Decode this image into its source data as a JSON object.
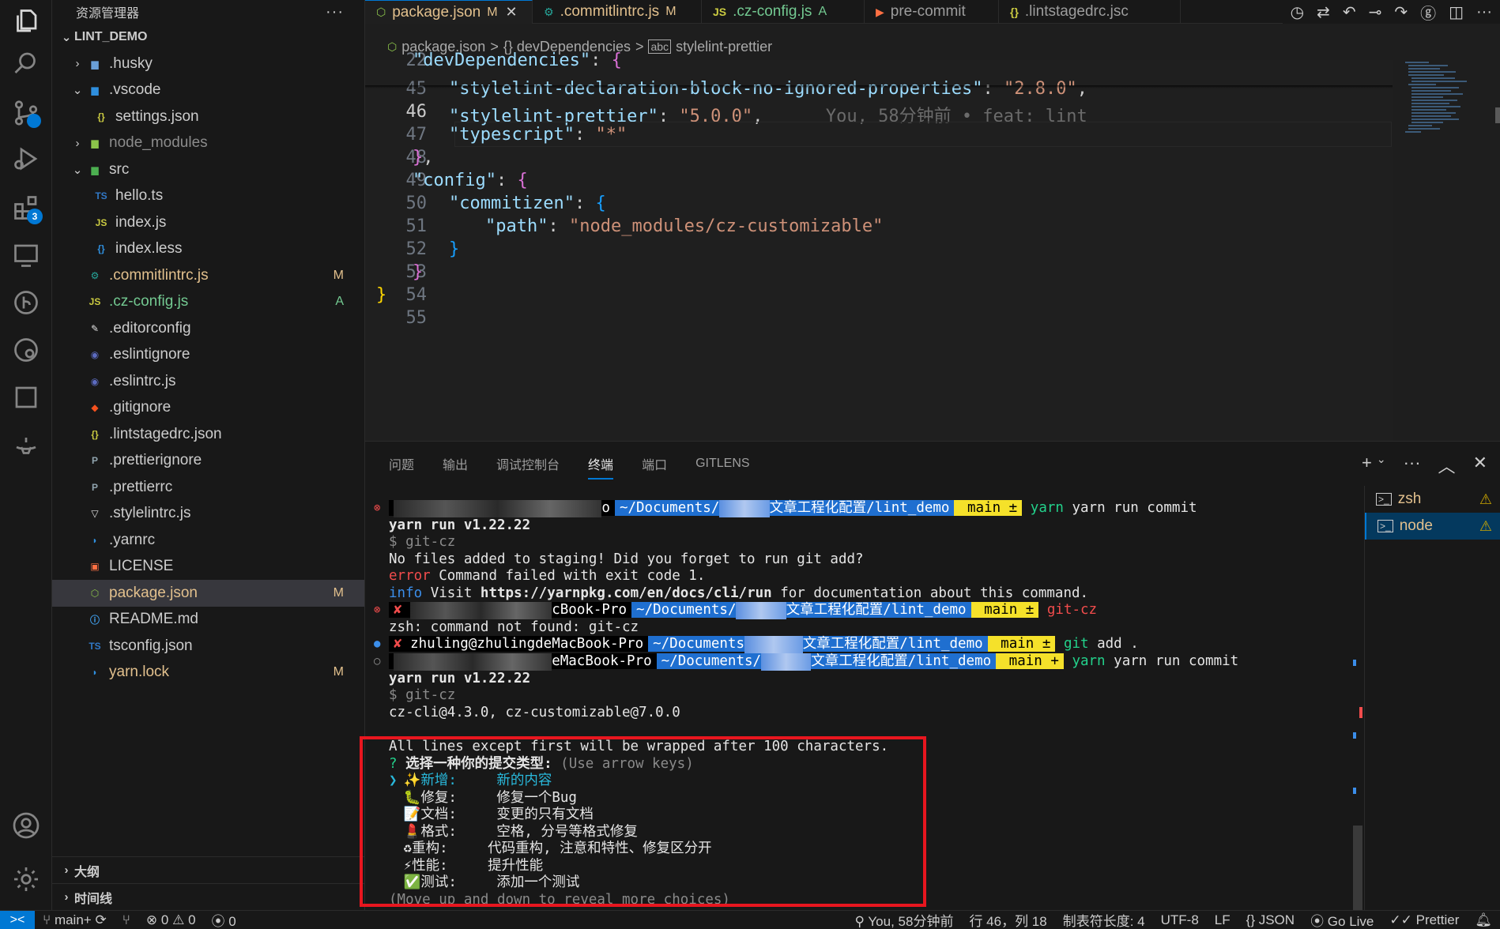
{
  "activity": {
    "extensions_badge": "3"
  },
  "sidebar": {
    "title": "资源管理器",
    "more": "···",
    "root": "LINT_DEMO",
    "items": [
      {
        "label": ".husky",
        "type": "folder",
        "chev": ">",
        "depth": 1,
        "color": "#cccccc",
        "icon": "folder-icon",
        "badge": ""
      },
      {
        "label": ".vscode",
        "type": "folder",
        "chev": "v",
        "depth": 1,
        "color": "#cccccc",
        "icon": "folder-vscode-icon",
        "badge": ""
      },
      {
        "label": "settings.json",
        "type": "file",
        "chev": "",
        "depth": 2,
        "color": "#cccccc",
        "icon": "json-icon",
        "badge": ""
      },
      {
        "label": "node_modules",
        "type": "folder",
        "chev": ">",
        "depth": 1,
        "color": "#8b8b8b",
        "icon": "folder-node-icon",
        "badge": ""
      },
      {
        "label": "src",
        "type": "folder",
        "chev": "v",
        "depth": 1,
        "color": "#cccccc",
        "icon": "folder-src-icon",
        "badge": ""
      },
      {
        "label": "hello.ts",
        "type": "file",
        "chev": "",
        "depth": 2,
        "color": "#cccccc",
        "icon": "ts-icon",
        "badge": ""
      },
      {
        "label": "index.js",
        "type": "file",
        "chev": "",
        "depth": 2,
        "color": "#cccccc",
        "icon": "js-icon",
        "badge": ""
      },
      {
        "label": "index.less",
        "type": "file",
        "chev": "",
        "depth": 2,
        "color": "#cccccc",
        "icon": "less-icon",
        "badge": ""
      },
      {
        "label": ".commitlintrc.js",
        "type": "file",
        "chev": "",
        "depth": 1,
        "color": "#e2c08d",
        "icon": "commitlint-icon",
        "badge": "M"
      },
      {
        "label": ".cz-config.js",
        "type": "file",
        "chev": "",
        "depth": 1,
        "color": "#73c991",
        "icon": "js-icon",
        "badge": "A"
      },
      {
        "label": ".editorconfig",
        "type": "file",
        "chev": "",
        "depth": 1,
        "color": "#cccccc",
        "icon": "editorconfig-icon",
        "badge": ""
      },
      {
        "label": ".eslintignore",
        "type": "file",
        "chev": "",
        "depth": 1,
        "color": "#cccccc",
        "icon": "eslint-icon",
        "badge": ""
      },
      {
        "label": ".eslintrc.js",
        "type": "file",
        "chev": "",
        "depth": 1,
        "color": "#cccccc",
        "icon": "eslint-icon",
        "badge": ""
      },
      {
        "label": ".gitignore",
        "type": "file",
        "chev": "",
        "depth": 1,
        "color": "#cccccc",
        "icon": "git-icon",
        "badge": ""
      },
      {
        "label": ".lintstagedrc.json",
        "type": "file",
        "chev": "",
        "depth": 1,
        "color": "#cccccc",
        "icon": "json-icon",
        "badge": ""
      },
      {
        "label": ".prettierignore",
        "type": "file",
        "chev": "",
        "depth": 1,
        "color": "#cccccc",
        "icon": "prettier-icon",
        "badge": ""
      },
      {
        "label": ".prettierrc",
        "type": "file",
        "chev": "",
        "depth": 1,
        "color": "#cccccc",
        "icon": "prettier-icon",
        "badge": ""
      },
      {
        "label": ".stylelintrc.js",
        "type": "file",
        "chev": "",
        "depth": 1,
        "color": "#cccccc",
        "icon": "stylelint-icon",
        "badge": ""
      },
      {
        "label": ".yarnrc",
        "type": "file",
        "chev": "",
        "depth": 1,
        "color": "#cccccc",
        "icon": "yarn-icon",
        "badge": ""
      },
      {
        "label": "LICENSE",
        "type": "file",
        "chev": "",
        "depth": 1,
        "color": "#cccccc",
        "icon": "license-icon",
        "badge": ""
      },
      {
        "label": "package.json",
        "type": "file",
        "chev": "",
        "depth": 1,
        "color": "#e2c08d",
        "icon": "nodejs-icon",
        "badge": "M",
        "selected": true
      },
      {
        "label": "README.md",
        "type": "file",
        "chev": "",
        "depth": 1,
        "color": "#cccccc",
        "icon": "info-icon",
        "badge": ""
      },
      {
        "label": "tsconfig.json",
        "type": "file",
        "chev": "",
        "depth": 1,
        "color": "#cccccc",
        "icon": "tsconfig-icon",
        "badge": ""
      },
      {
        "label": "yarn.lock",
        "type": "file",
        "chev": "",
        "depth": 1,
        "color": "#e2c08d",
        "icon": "yarn-icon",
        "badge": "M"
      }
    ],
    "outline": "大纲",
    "timeline": "时间线"
  },
  "tabs": [
    {
      "label": "package.json",
      "status": "M",
      "active": true,
      "icon": "nodejs-icon",
      "status_color": "#e2c08d",
      "label_color": "#e2c08d"
    },
    {
      "label": ".commitlintrc.js",
      "status": "M",
      "active": false,
      "icon": "commitlint-icon",
      "status_color": "#e2c08d",
      "label_color": "#e2c08d"
    },
    {
      "label": ".cz-config.js",
      "status": "A",
      "active": false,
      "icon": "js-icon",
      "status_color": "#73c991",
      "label_color": "#73c991"
    },
    {
      "label": "pre-commit",
      "status": "",
      "active": false,
      "icon": "shell-icon",
      "status_color": "",
      "label_color": "#9d9d9d"
    },
    {
      "label": ".lintstagedrc.jsc",
      "status": "",
      "active": false,
      "icon": "json-icon",
      "status_color": "",
      "label_color": "#9d9d9d"
    }
  ],
  "breadcrumb": {
    "file": "package.json",
    "sep": ">",
    "node1": "{} devDependencies",
    "node2": "stylelint-prettier"
  },
  "editor": {
    "lines": [
      {
        "n": "22",
        "cur": false
      },
      {
        "n": "45",
        "cur": false
      },
      {
        "n": "46",
        "cur": true
      },
      {
        "n": "47",
        "cur": false
      },
      {
        "n": "48",
        "cur": false
      },
      {
        "n": "49",
        "cur": false
      },
      {
        "n": "50",
        "cur": false
      },
      {
        "n": "51",
        "cur": false
      },
      {
        "n": "52",
        "cur": false
      },
      {
        "n": "53",
        "cur": false
      },
      {
        "n": "54",
        "cur": false
      },
      {
        "n": "55",
        "cur": false
      }
    ],
    "code": {
      "l22_key": "\"devDependencies\"",
      "l45_key": "\"stylelint-declaration-block-no-ignored-properties\"",
      "l45_val": "\"2.8.0\"",
      "l46_key": "\"stylelint-prettier\"",
      "l46_val": "\"5.0.0\"",
      "l46_blame": "You, 58分钟前 • feat: lint",
      "l47_key": "\"typescript\"",
      "l47_val": "\"*\"",
      "l49_key": "\"config\"",
      "l50_key": "\"commitizen\"",
      "l51_key": "\"path\"",
      "l51_val": "\"node_modules/cz-customizable\""
    }
  },
  "panel": {
    "tabs": [
      "问题",
      "输出",
      "调试控制台",
      "终端",
      "端口",
      "GITLENS"
    ],
    "active_tab": "终端",
    "actions": [
      "+",
      "⌄",
      "···",
      "^",
      "×"
    ],
    "terminals": [
      {
        "name": "zsh",
        "active": false
      },
      {
        "name": "node",
        "active": true
      }
    ]
  },
  "terminal": {
    "prompt1_dir": "~/Documents/",
    "prompt1_dir2": "文章工程化配置/lint_demo",
    "prompt_git": " main ±",
    "prompt_git_plus": " main +",
    "cmd1": "yarn run commit",
    "out_yarn": "yarn run v1.22.22",
    "out_gitcz": "$ git-cz",
    "out_nofiles": "No files added to staging! Did you forget to run git add?",
    "out_error_kw": "error",
    "out_error_msg": " Command failed with exit code 1.",
    "out_info_kw": "info",
    "out_info_msg1": " Visit ",
    "out_info_url": "https://yarnpkg.com/en/docs/cli/run",
    "out_info_msg2": " for documentation about this command.",
    "prompt2_user": "cBook-Pro",
    "cmd2": "git-cz",
    "out_zsh": "zsh: command not found: git-cz",
    "prompt3_user": "zhuling@zhulingdeMacBook-Pro",
    "prompt3_dir": "~/Documents",
    "cmd3_a": "git",
    "cmd3_b": " add .",
    "prompt4_user": "eMacBook-Pro",
    "cmd4": "yarn run commit",
    "out_yarn2": "yarn run v1.22.22",
    "out_gitcz2": "$ git-cz",
    "out_czcli": "cz-cli@4.3.0, cz-customizable@7.0.0",
    "out_wrap": "All lines except first will be wrapped after 100 characters.",
    "q_mark": "?",
    "q_text": " 选择一种你的提交类型: ",
    "q_hint": "(Use arrow keys)",
    "choices": [
      {
        "pointer": "❯",
        "icon": "✨",
        "name": "新增:",
        "desc": "新的内容",
        "selected": true
      },
      {
        "pointer": " ",
        "icon": "🐛",
        "name": "修复:",
        "desc": "修复一个Bug",
        "selected": false
      },
      {
        "pointer": " ",
        "icon": "📝",
        "name": "文档:",
        "desc": "变更的只有文档",
        "selected": false
      },
      {
        "pointer": " ",
        "icon": "💄",
        "name": "格式:",
        "desc": "空格, 分号等格式修复",
        "selected": false
      },
      {
        "pointer": " ",
        "icon": "♻",
        "name": "重构:",
        "desc": "代码重构, 注意和特性、修复区分开",
        "selected": false
      },
      {
        "pointer": " ",
        "icon": "⚡",
        "name": "性能:",
        "desc": "提升性能",
        "selected": false
      },
      {
        "pointer": " ",
        "icon": "✅",
        "name": "测试:",
        "desc": "添加一个测试",
        "selected": false
      }
    ],
    "more_hint": "(Move up and down to reveal more choices)"
  },
  "statusbar": {
    "remote": "><",
    "branch": "main+",
    "errors": "0",
    "warnings": "0",
    "ports": "0",
    "blame": "You, 58分钟前",
    "position": "行 46，列 18",
    "tab_size": "制表符长度: 4",
    "encoding": "UTF-8",
    "eol": "LF",
    "language": "{} JSON",
    "golive": "Go Live",
    "prettier": "✓✓ Prettier"
  }
}
